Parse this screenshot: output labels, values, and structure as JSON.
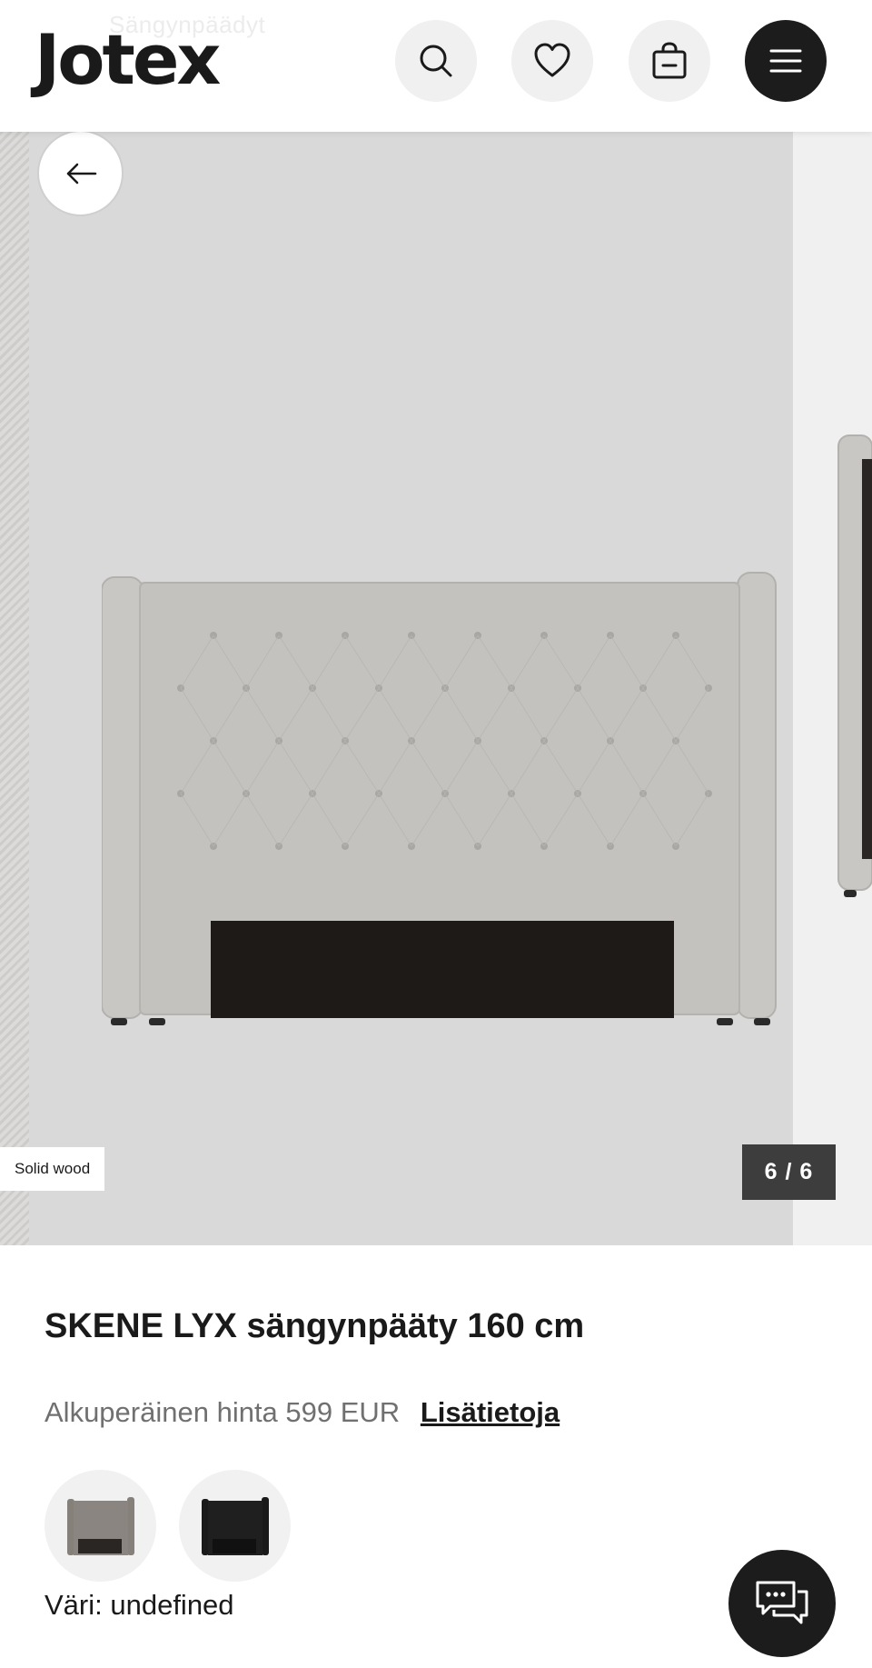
{
  "header": {
    "logo": "Jotex",
    "ghost_breadcrumb": "Sängynpäädyt"
  },
  "gallery": {
    "badge": "Solid wood",
    "counter": "6 / 6",
    "current": 6,
    "total": 6
  },
  "product": {
    "title": "SKENE LYX sängynpääty 160 cm",
    "price_label": "Alkuperäinen hinta 599 EUR",
    "price_link": "Lisätietoja",
    "color_label": "Väri: undefined",
    "swatches": [
      {
        "name": "grey",
        "color": "#8a8580"
      },
      {
        "name": "black",
        "color": "#1f1f1f"
      }
    ]
  },
  "colors": {
    "accent_dark": "#1c1c1c",
    "gallery_bg": "#d9d9d9",
    "headboard_fabric": "#c4c2bf"
  },
  "icons": [
    "search-icon",
    "heart-icon",
    "shopping-bag-icon",
    "menu-icon",
    "arrow-left-icon",
    "chat-icon"
  ]
}
